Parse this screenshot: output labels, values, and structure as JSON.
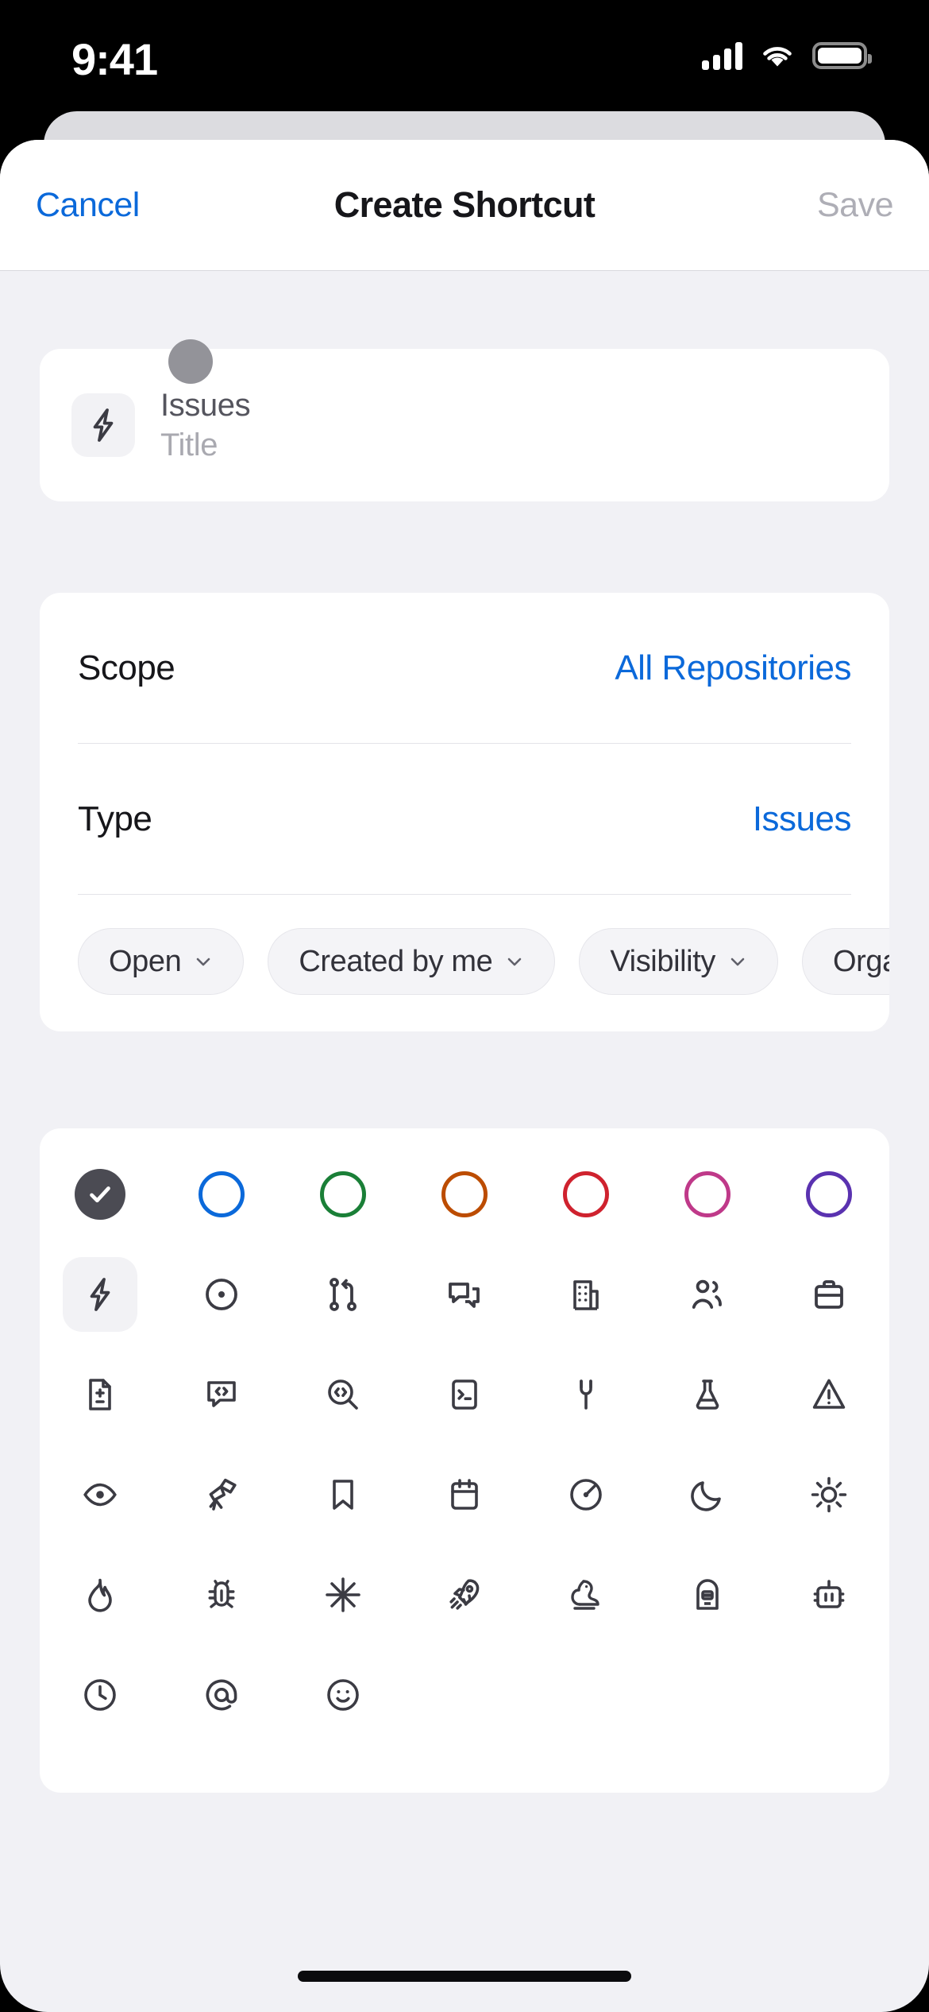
{
  "status_bar": {
    "time": "9:41",
    "cellular_icon": "cellular-signal-icon",
    "wifi_icon": "wifi-icon",
    "battery_icon": "battery-full-icon"
  },
  "navbar": {
    "cancel_label": "Cancel",
    "title": "Create Shortcut",
    "save_label": "Save"
  },
  "preview": {
    "icon": "zap-icon",
    "name": "Issues",
    "title_placeholder": "Title"
  },
  "settings": {
    "rows": [
      {
        "label": "Scope",
        "value": "All Repositories"
      },
      {
        "label": "Type",
        "value": "Issues"
      }
    ],
    "chips": [
      {
        "label": "Open"
      },
      {
        "label": "Created by me"
      },
      {
        "label": "Visibility"
      },
      {
        "label": "Organ"
      }
    ]
  },
  "picker": {
    "colors": [
      {
        "name": "gray",
        "ring": "#4b4b53",
        "tile": "#f6f6f8",
        "selected": true
      },
      {
        "name": "blue",
        "ring": "#0b69da",
        "tile": "#eff4fe",
        "selected": false
      },
      {
        "name": "green",
        "ring": "#1a7f37",
        "tile": "#eefbf0",
        "selected": false
      },
      {
        "name": "orange",
        "ring": "#bc4c00",
        "tile": "#fef3ea",
        "selected": false
      },
      {
        "name": "red",
        "ring": "#cf222e",
        "tile": "#fdf0f1",
        "selected": false
      },
      {
        "name": "pink",
        "ring": "#bf3989",
        "tile": "#fdf0f8",
        "selected": false
      },
      {
        "name": "purple",
        "ring": "#5a32b0",
        "tile": "#f5f1fd",
        "selected": false
      }
    ],
    "selected_color": "gray",
    "selected_icon": "zap-icon",
    "icons": [
      "zap-icon",
      "issue-opened-icon",
      "git-pull-request-icon",
      "comment-discussion-icon",
      "organization-icon",
      "people-icon",
      "briefcase-icon",
      "file-diff-icon",
      "code-review-icon",
      "code-search-icon",
      "terminal-icon",
      "tools-icon",
      "beaker-icon",
      "alert-icon",
      "eye-icon",
      "telescope-icon",
      "bookmark-icon",
      "calendar-icon",
      "dashboard-icon",
      "moon-icon",
      "sun-icon",
      "flame-icon",
      "bug-icon",
      "north-star-icon",
      "rocket-icon",
      "squirrel-icon",
      "hubot-icon",
      "copilot-icon",
      "clock-icon",
      "mention-icon",
      "smiley-icon"
    ]
  },
  "colors": {
    "accent_blue": "#0b69da",
    "sheet_background": "#f1f1f5",
    "card_background": "#ffffff",
    "text_primary": "#16161a",
    "text_muted": "#a9a9b0"
  }
}
